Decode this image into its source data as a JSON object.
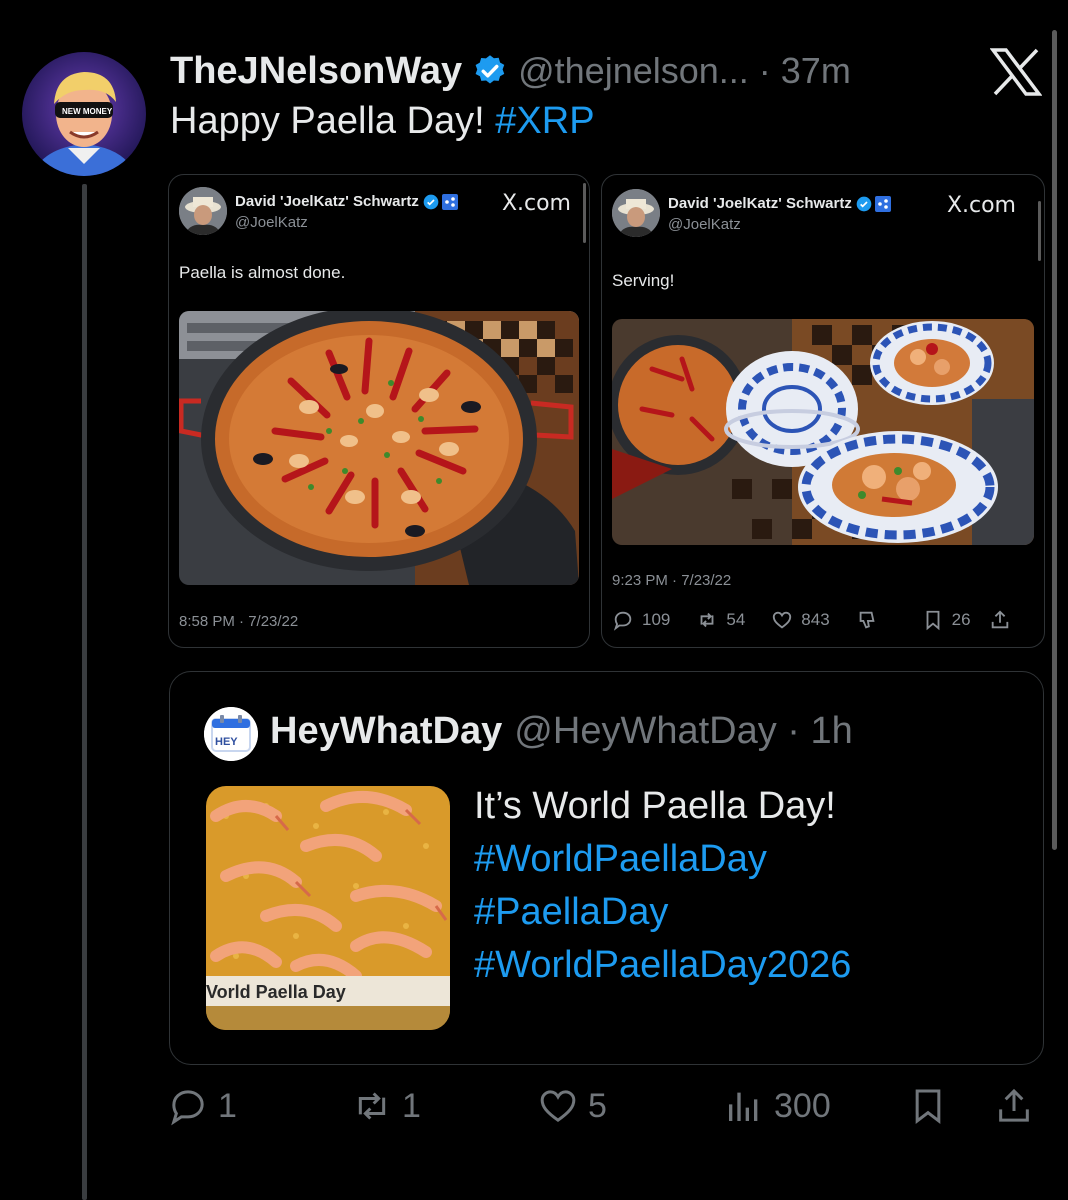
{
  "post": {
    "author_name": "TheJNelsonWay",
    "handle_time": "@thejnelson... · 37m",
    "text": "Happy Paella Day! ",
    "hashtag": "#XRP",
    "avatar_text": "NEW MONEY"
  },
  "embeds": [
    {
      "author": "David 'JoelKatz' Schwartz",
      "handle": "@JoelKatz",
      "source": "X.com",
      "text": "Paella is almost done.",
      "time": "8:58 PM · 7/23/22"
    },
    {
      "author": "David 'JoelKatz' Schwartz",
      "handle": "@JoelKatz",
      "source": "X.com",
      "text": "Serving!",
      "time": "9:23 PM · 7/23/22",
      "replies": "109",
      "reposts": "54",
      "likes": "843",
      "bookmarks": "26"
    }
  ],
  "quote": {
    "author_name": "HeyWhatDay",
    "handle_time": "@HeyWhatDay · 1h",
    "avatar_text": "HEY",
    "text": "It’s World Paella Day!",
    "hashtags": [
      "#WorldPaellaDay",
      "#PaellaDay",
      "#WorldPaellaDay2026"
    ],
    "image_caption": "Vorld Paella Day"
  },
  "actions": {
    "replies": "1",
    "reposts": "1",
    "likes": "5",
    "views": "300"
  },
  "colors": {
    "background": "#000000",
    "link": "#1d9bf0",
    "muted": "#71767b",
    "text": "#e7e9ea"
  }
}
